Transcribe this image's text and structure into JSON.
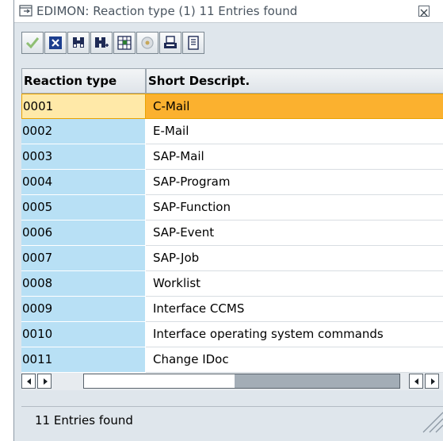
{
  "window": {
    "title": "EDIMON: Reaction type (1)   11 Entries found"
  },
  "toolbar": {
    "buttons": [
      {
        "name": "continue-checkmark",
        "icon": "checkmark-icon"
      },
      {
        "name": "cancel",
        "icon": "close-x-icon"
      },
      {
        "name": "find",
        "icon": "binoculars-icon"
      },
      {
        "name": "find-next",
        "icon": "binoculars-plus-icon"
      },
      {
        "name": "select",
        "icon": "select-grid-icon"
      },
      {
        "name": "help",
        "icon": "help-disc-icon"
      },
      {
        "name": "print",
        "icon": "printer-icon"
      },
      {
        "name": "details",
        "icon": "document-icon"
      }
    ]
  },
  "table": {
    "columns": [
      "Reaction type",
      "Short Descript."
    ],
    "rows": [
      {
        "key": "0001",
        "desc": "C-Mail"
      },
      {
        "key": "0002",
        "desc": "E-Mail"
      },
      {
        "key": "0003",
        "desc": "SAP-Mail"
      },
      {
        "key": "0004",
        "desc": "SAP-Program"
      },
      {
        "key": "0005",
        "desc": "SAP-Function"
      },
      {
        "key": "0006",
        "desc": "SAP-Event"
      },
      {
        "key": "0007",
        "desc": "SAP-Job"
      },
      {
        "key": "0008",
        "desc": "Worklist"
      },
      {
        "key": "0009",
        "desc": "Interface CCMS"
      },
      {
        "key": "0010",
        "desc": "Interface operating system commands"
      },
      {
        "key": "0011",
        "desc": "Change IDoc"
      }
    ],
    "selected_row": 1
  },
  "status": {
    "text": "11 Entries found"
  },
  "colors": {
    "key_column": "#b8e0f5",
    "selected_row": "#fbb12f",
    "window_bg": "#dfe6ec"
  }
}
